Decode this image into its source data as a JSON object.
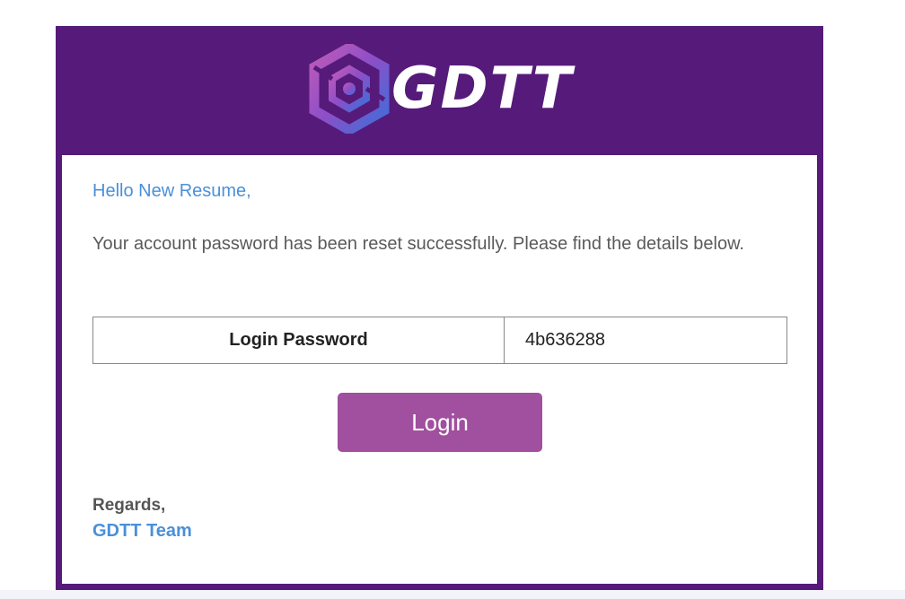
{
  "brand": {
    "name": "GDTT",
    "header_color": "#561b7a",
    "logo_gradient": [
      "#b04fb0",
      "#3d6fd9"
    ]
  },
  "email": {
    "greeting": "Hello New Resume,",
    "message": "Your account password has been reset successfully. Please find the details below.",
    "details": [
      {
        "label": "Login Password",
        "value": "4b636288"
      }
    ],
    "button_label": "Login",
    "button_color": "#a0509e",
    "signoff": "Regards,",
    "team": "GDTT Team",
    "link_color": "#4a90d9"
  }
}
